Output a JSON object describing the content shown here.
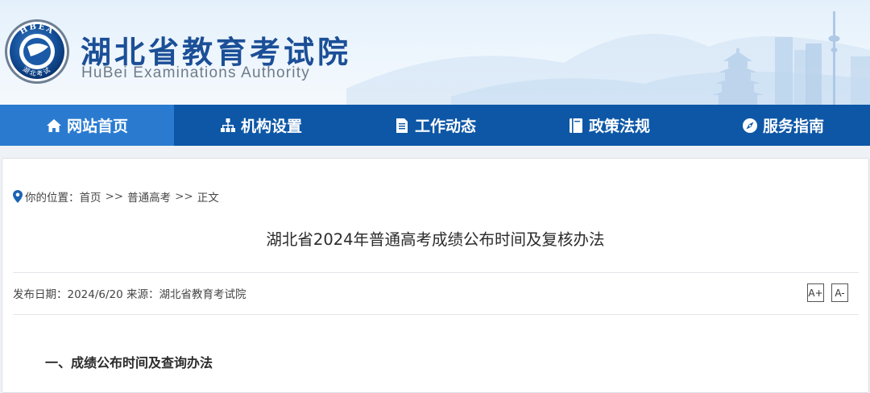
{
  "site": {
    "title": "湖北省教育考试院",
    "subtitle": "HuBei Examinations Authority",
    "logo_text": "HBEA",
    "logo_subtext": "湖北考试"
  },
  "nav": {
    "items": [
      {
        "label": "网站首页",
        "icon": "home-icon",
        "active": true
      },
      {
        "label": "机构设置",
        "icon": "org-chart-icon",
        "active": false
      },
      {
        "label": "工作动态",
        "icon": "document-icon",
        "active": false
      },
      {
        "label": "政策法规",
        "icon": "book-icon",
        "active": false
      },
      {
        "label": "服务指南",
        "icon": "compass-icon",
        "active": false
      }
    ]
  },
  "breadcrumb": {
    "prefix": "你的位置：",
    "items": [
      "首页",
      "普通高考",
      "正文"
    ],
    "separator": ">>"
  },
  "article": {
    "title": "湖北省2024年普通高考成绩公布时间及复核办法",
    "meta": "发布日期：2024/6/20 来源：湖北省教育考试院",
    "font_increase": "A+",
    "font_decrease": "A-",
    "section_heading": "一、成绩公布时间及查询办法"
  },
  "colors": {
    "nav_bg": "#0d57a6",
    "nav_active": "#2a7bd0",
    "title_blue": "#1b4f97"
  }
}
